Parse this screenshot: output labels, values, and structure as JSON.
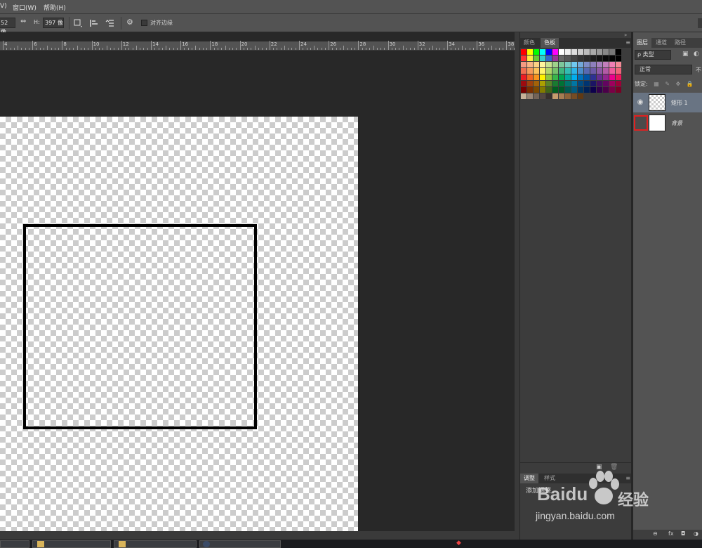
{
  "menubar": {
    "items": [
      "V)",
      "窗口(W)",
      "帮助(H)"
    ]
  },
  "options_bar": {
    "width_value": "52 像",
    "height_label": "H:",
    "height_value": "397 像",
    "align_edges_label": "对齐边缘"
  },
  "ruler": {
    "labels": [
      "4",
      "6",
      "8",
      "10",
      "12",
      "14",
      "16",
      "18",
      "20",
      "22",
      "24",
      "26",
      "28",
      "30",
      "32",
      "34",
      "36",
      "38"
    ]
  },
  "swatches_panel": {
    "tabs": [
      "颜色",
      "色板"
    ],
    "active_tab": "色板",
    "colors": [
      "#ff0000",
      "#ffff00",
      "#00ff00",
      "#00ffff",
      "#0000ff",
      "#ff00ff",
      "#ffffff",
      "#eeeeee",
      "#dddddd",
      "#cccccc",
      "#bbbbbb",
      "#aaaaaa",
      "#999999",
      "#888888",
      "#777777",
      "#000000",
      "#ff3333",
      "#ffee44",
      "#66cc33",
      "#33cccc",
      "#3366cc",
      "#993399",
      "#666666",
      "#555555",
      "#444444",
      "#333333",
      "#2a2a2a",
      "#1e1e1e",
      "#141414",
      "#0a0a0a",
      "#050505",
      "#000000",
      "#f49a82",
      "#f8b586",
      "#fbd184",
      "#fff59d",
      "#c8e290",
      "#9fd18b",
      "#7cc79b",
      "#79cbc2",
      "#70c8f0",
      "#72a8d9",
      "#7e8cc6",
      "#8e7fbd",
      "#a67fbd",
      "#c27ebc",
      "#f07fb4",
      "#f38a96",
      "#f16d50",
      "#f59b5a",
      "#fbc25a",
      "#fff46c",
      "#b0d66a",
      "#74c06b",
      "#3fb57f",
      "#32bcb2",
      "#2ab4e8",
      "#4b8dcb",
      "#5869b2",
      "#6c59a6",
      "#8e59a5",
      "#b35aa6",
      "#ef5a9c",
      "#f06479",
      "#ed1c24",
      "#f26522",
      "#f7941d",
      "#fff200",
      "#8dc63f",
      "#39b54a",
      "#00a651",
      "#00a99d",
      "#00aeef",
      "#0072bc",
      "#0054a6",
      "#2e3192",
      "#662d91",
      "#92278f",
      "#ec008c",
      "#ed145b",
      "#9e0b0f",
      "#a0410d",
      "#a36209",
      "#aba000",
      "#598527",
      "#197b30",
      "#007236",
      "#00746b",
      "#0076a3",
      "#004a80",
      "#003471",
      "#1b1464",
      "#440e62",
      "#630460",
      "#9e005d",
      "#9e0039",
      "#790000",
      "#7b2e00",
      "#7d4900",
      "#827b00",
      "#406618",
      "#005e20",
      "#005826",
      "#005952",
      "#005b7f",
      "#003663",
      "#002157",
      "#0d004c",
      "#32004b",
      "#4b0049",
      "#7b0046",
      "#7a0026",
      "#c7b299",
      "#998675",
      "#736357",
      "#534741",
      "#37302d",
      "#c69c6d",
      "#a67c52",
      "#8c6239",
      "#754c24",
      "#603913"
    ]
  },
  "adjust_panel": {
    "tabs": [
      "调整",
      "样式"
    ],
    "title": "添加调整"
  },
  "layers_panel": {
    "tabs": [
      "图层",
      "通道",
      "路径"
    ],
    "filter_label": "ρ 类型",
    "blend_mode": "正常",
    "opacity_label": "不",
    "lock_label": "锁定:",
    "layers": [
      {
        "name": "矩形 1",
        "selected": true,
        "visible": true
      },
      {
        "name": "背景",
        "selected": false,
        "visible": false
      }
    ]
  },
  "watermark": {
    "brand": "Baidu",
    "cn": "经验",
    "url": "jingyan.baidu.com"
  }
}
